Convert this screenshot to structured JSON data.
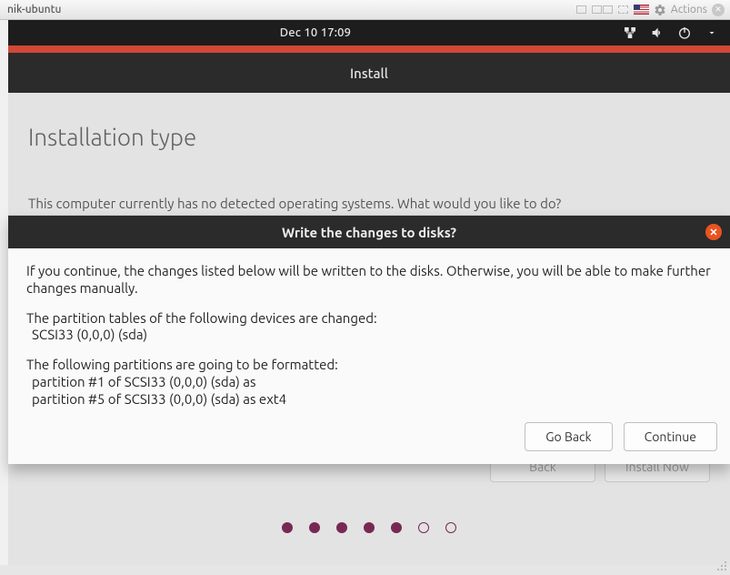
{
  "vm": {
    "title": "nik-ubuntu",
    "actions_label": "Actions"
  },
  "gnome": {
    "clock": "Dec 10  17:09"
  },
  "window": {
    "title": "Install"
  },
  "page": {
    "title": "Installation type",
    "body": "This computer currently has no detected operating systems. What would you like to do?",
    "back_label": "Back",
    "install_now_label": "Install Now"
  },
  "progress": {
    "total": 7,
    "current": 5
  },
  "dialog": {
    "title": "Write the changes to disks?",
    "intro": "If you continue, the changes listed below will be written to the disks. Otherwise, you will be able to make further changes manually.",
    "tables_heading": "The partition tables of the following devices are changed:",
    "tables": [
      "SCSI33 (0,0,0) (sda)"
    ],
    "format_heading": "The following partitions are going to be formatted:",
    "formats": [
      "partition #1 of SCSI33 (0,0,0) (sda) as",
      "partition #5 of SCSI33 (0,0,0) (sda) as ext4"
    ],
    "go_back_label": "Go Back",
    "continue_label": "Continue"
  }
}
